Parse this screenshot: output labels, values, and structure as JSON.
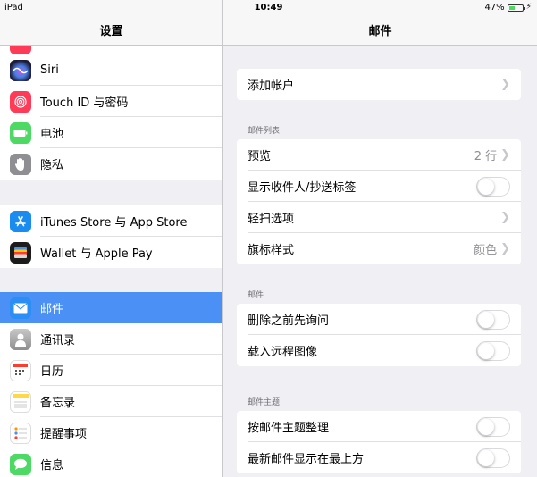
{
  "status_bar": {
    "device": "iPad",
    "time": "10:49",
    "battery": "47%",
    "battery_level": 0.47
  },
  "left_pane": {
    "title": "设置",
    "groups": [
      {
        "items": [
          {
            "label": "Siri",
            "icon": "siri-icon",
            "color": "#2a2a5a"
          },
          {
            "label": "Touch ID 与密码",
            "icon": "fingerprint-icon",
            "color": "#ff3b58"
          },
          {
            "label": "电池",
            "icon": "battery-icon",
            "color": "#4cd964"
          },
          {
            "label": "隐私",
            "icon": "hand-icon",
            "color": "#8e8e93"
          }
        ]
      },
      {
        "items": [
          {
            "label": "iTunes Store 与 App Store",
            "icon": "app-store-icon",
            "color": "#1a8cf0"
          },
          {
            "label": "Wallet 与 Apple Pay",
            "icon": "wallet-icon",
            "color": "#1c1c1c"
          }
        ]
      },
      {
        "items": [
          {
            "label": "邮件",
            "icon": "mail-icon",
            "color": "#2a8ef5",
            "selected": true
          },
          {
            "label": "通讯录",
            "icon": "contacts-icon",
            "color": "#9a9a9a"
          },
          {
            "label": "日历",
            "icon": "calendar-icon",
            "color": "#ffffff"
          },
          {
            "label": "备忘录",
            "icon": "notes-icon",
            "color": "#ffd84a"
          },
          {
            "label": "提醒事项",
            "icon": "reminders-icon",
            "color": "#ffffff"
          },
          {
            "label": "信息",
            "icon": "messages-icon",
            "color": "#4cd964"
          }
        ]
      }
    ]
  },
  "right_pane": {
    "title": "邮件",
    "add_account": "添加帐户",
    "sections": [
      {
        "header": "邮件列表",
        "rows": [
          {
            "label": "预览",
            "value": "2 行",
            "type": "chevron"
          },
          {
            "label": "显示收件人/抄送标签",
            "type": "toggle",
            "on": false
          },
          {
            "label": "轻扫选项",
            "type": "chevron"
          },
          {
            "label": "旗标样式",
            "value": "颜色",
            "type": "chevron"
          }
        ]
      },
      {
        "header": "邮件",
        "rows": [
          {
            "label": "删除之前先询问",
            "type": "toggle",
            "on": false
          },
          {
            "label": "载入远程图像",
            "type": "toggle",
            "on": false
          }
        ]
      },
      {
        "header": "邮件主题",
        "rows": [
          {
            "label": "按邮件主题整理",
            "type": "toggle",
            "on": false
          },
          {
            "label": "最新邮件显示在最上方",
            "type": "toggle",
            "on": false
          }
        ]
      }
    ]
  }
}
